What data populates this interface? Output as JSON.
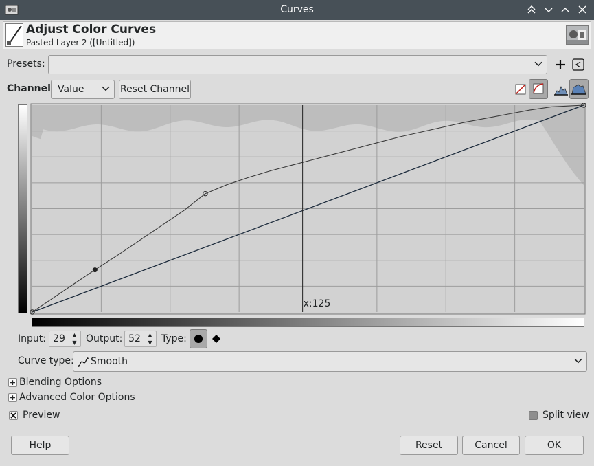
{
  "window": {
    "title": "Curves"
  },
  "titlebar_buttons": [
    "keep-above",
    "minimize",
    "maximize",
    "close"
  ],
  "header": {
    "title": "Adjust Color Curves",
    "subtitle": "Pasted Layer-2 ([Untitled])"
  },
  "presets": {
    "label": "Presets:",
    "value": ""
  },
  "channel": {
    "label": "Channel:",
    "value": "Value",
    "reset_label": "Reset Channel"
  },
  "graph": {
    "cursor_label": "x:125",
    "grid_divisions": 8
  },
  "curve": {
    "control_points": [
      [
        0,
        0
      ],
      [
        29,
        52
      ],
      [
        80,
        146
      ],
      [
        255,
        255
      ]
    ],
    "smooth_points": [
      [
        0,
        0
      ],
      [
        10,
        18
      ],
      [
        20,
        36
      ],
      [
        29,
        52
      ],
      [
        40,
        71
      ],
      [
        50,
        89
      ],
      [
        60,
        107
      ],
      [
        70,
        125
      ],
      [
        80,
        146
      ],
      [
        90,
        157
      ],
      [
        100,
        166
      ],
      [
        110,
        174
      ],
      [
        120,
        181
      ],
      [
        130,
        188
      ],
      [
        140,
        195
      ],
      [
        150,
        202
      ],
      [
        160,
        209
      ],
      [
        170,
        216
      ],
      [
        180,
        222
      ],
      [
        190,
        228
      ],
      [
        200,
        234
      ],
      [
        210,
        239
      ],
      [
        220,
        244
      ],
      [
        230,
        249
      ],
      [
        240,
        253
      ],
      [
        255,
        255
      ]
    ],
    "selected_point": [
      29,
      52
    ]
  },
  "io": {
    "input_label": "Input:",
    "input_value": "29",
    "output_label": "Output:",
    "output_value": "52",
    "type_label": "Type:"
  },
  "curve_type": {
    "label": "Curve type:",
    "value": "Smooth"
  },
  "expanders": {
    "blending": "Blending Options",
    "advanced": "Advanced Color Options"
  },
  "preview": {
    "label": "Preview",
    "checked": true
  },
  "split_view": {
    "label": "Split view",
    "checked": false
  },
  "buttons": {
    "help": "Help",
    "reset": "Reset",
    "cancel": "Cancel",
    "ok": "OK"
  },
  "colors": {
    "titlebar": "#475057",
    "window": "#dcdcdc",
    "graph_bg": "#d2d2d2",
    "histogram": "#bdbdbd",
    "curve": "#3a3a3a",
    "identity_line": "#1c2b3c"
  }
}
